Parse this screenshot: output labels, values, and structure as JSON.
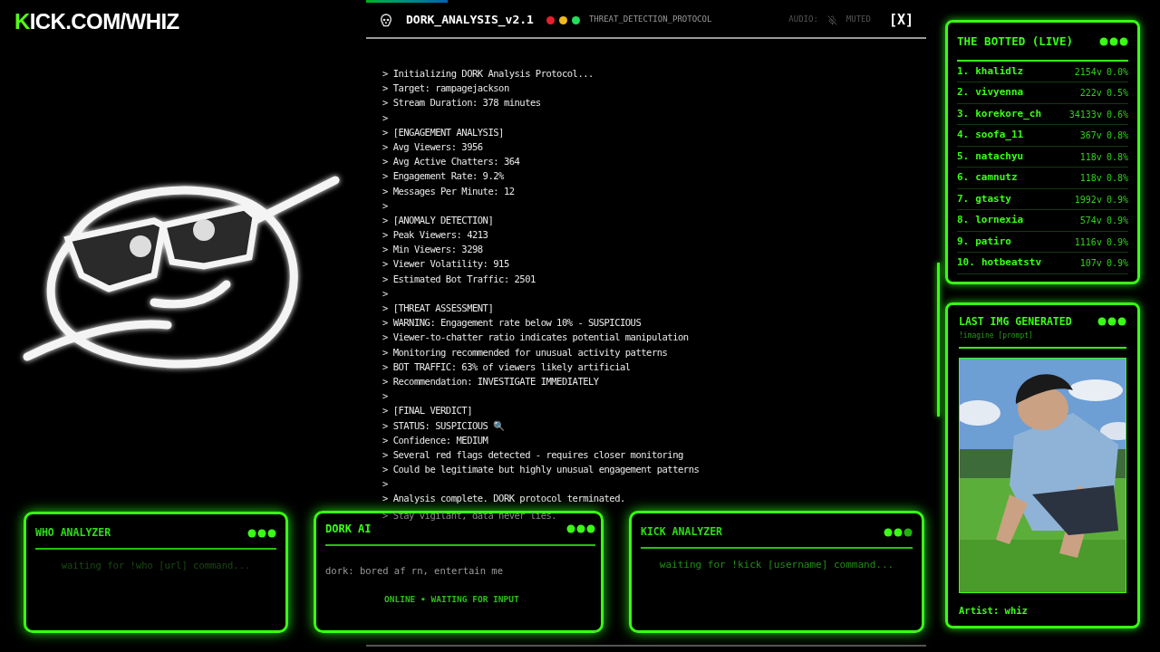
{
  "logo": {
    "accent": "K",
    "text": "ICK.COM/WHIZ"
  },
  "terminal": {
    "title": "DORK_ANALYSIS_v2.1",
    "lights": [
      {
        "color": "#e5202a"
      },
      {
        "color": "#f2b91c"
      },
      {
        "color": "#22e05a"
      }
    ],
    "subtitle": "THREAT_DETECTION_PROTOCOL",
    "audio_label": "AUDIO:",
    "muted": true,
    "audio_state": "MUTED",
    "close": "[X]",
    "lines": [
      "> Initializing DORK Analysis Protocol...",
      "> Target: rampagejackson",
      "> Stream Duration: 378 minutes",
      ">",
      "> [ENGAGEMENT ANALYSIS]",
      "> Avg Viewers: 3956",
      "> Avg Active Chatters: 364",
      "> Engagement Rate: 9.2%",
      "> Messages Per Minute: 12",
      ">",
      "> [ANOMALY DETECTION]",
      "> Peak Viewers: 4213",
      "> Min Viewers: 3298",
      "> Viewer Volatility: 915",
      "> Estimated Bot Traffic: 2501",
      ">",
      "> [THREAT ASSESSMENT]",
      "> WARNING: Engagement rate below 10% - SUSPICIOUS",
      "> Viewer-to-chatter ratio indicates potential manipulation",
      "> Monitoring recommended for unusual activity patterns",
      "> BOT TRAFFIC: 63% of viewers likely artificial",
      "> Recommendation: INVESTIGATE IMMEDIATELY",
      ">",
      "> [FINAL VERDICT]",
      "> STATUS: SUSPICIOUS 🔍",
      "> Confidence: MEDIUM",
      "> Several red flags detected - requires closer monitoring",
      "> Could be legitimate but highly unusual engagement patterns",
      ">",
      "> Analysis complete. DORK protocol terminated."
    ],
    "faded_line": "> Stay vigilant, data never lies."
  },
  "botted": {
    "title": "THE BOTTED (LIVE)",
    "rows": [
      {
        "rank": "1.",
        "name": "khalidlz",
        "viewers": "2154v",
        "pct": "0.0%"
      },
      {
        "rank": "2.",
        "name": "vivyenna",
        "viewers": "222v",
        "pct": "0.5%"
      },
      {
        "rank": "3.",
        "name": "korekore_ch",
        "viewers": "34133v",
        "pct": "0.6%"
      },
      {
        "rank": "4.",
        "name": "soofa_11",
        "viewers": "367v",
        "pct": "0.8%"
      },
      {
        "rank": "5.",
        "name": "natachyu",
        "viewers": "118v",
        "pct": "0.8%"
      },
      {
        "rank": "6.",
        "name": "camnutz",
        "viewers": "118v",
        "pct": "0.8%"
      },
      {
        "rank": "7.",
        "name": "gtasty",
        "viewers": "1992v",
        "pct": "0.9%"
      },
      {
        "rank": "8.",
        "name": "lornexia",
        "viewers": "574v",
        "pct": "0.9%"
      },
      {
        "rank": "9.",
        "name": "patiro",
        "viewers": "1116v",
        "pct": "0.9%"
      },
      {
        "rank": "10.",
        "name": "hotbeatstv",
        "viewers": "107v",
        "pct": "0.9%"
      }
    ]
  },
  "last_img": {
    "title": "LAST IMG GENERATED",
    "hint": "!imagine [prompt]",
    "artist": "Artist: whiz"
  },
  "who": {
    "title": "WHO ANALYZER",
    "message": "waiting for !who [url] command..."
  },
  "dork_ai": {
    "title": "DORK AI",
    "message": "dork: bored af rn, entertain me",
    "status": "ONLINE • WAITING FOR INPUT"
  },
  "kick": {
    "title": "KICK ANALYZER",
    "message": "waiting for !kick [username] command..."
  }
}
